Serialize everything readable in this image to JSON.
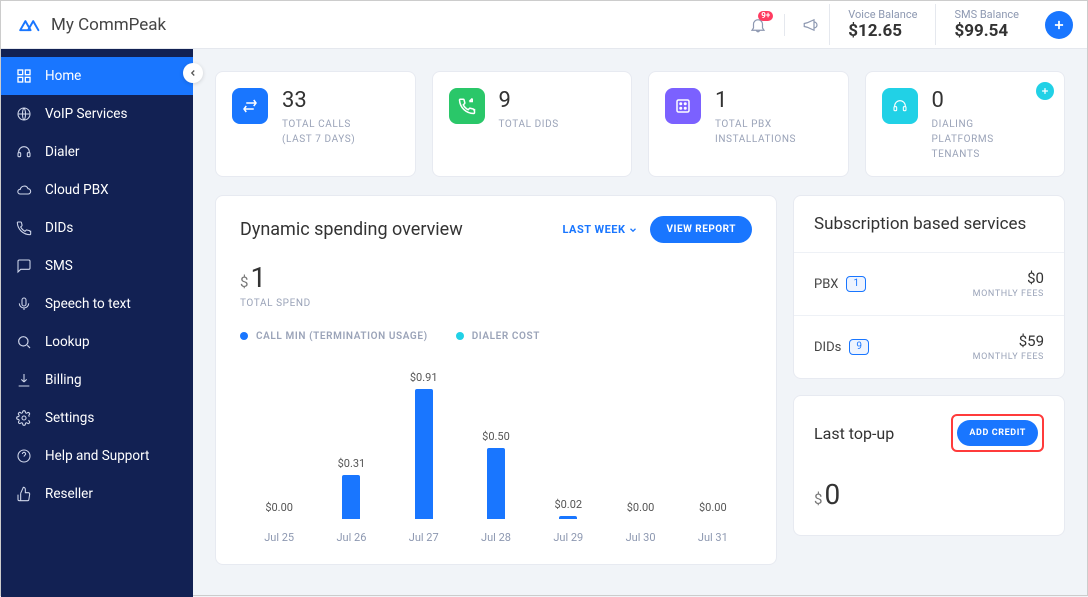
{
  "app_title": "My CommPeak",
  "header": {
    "notif_count": "9+",
    "voice_balance_label": "Voice Balance",
    "voice_balance_value": "$12.65",
    "sms_balance_label": "SMS Balance",
    "sms_balance_value": "$99.54"
  },
  "sidebar": {
    "items": [
      {
        "label": "Home",
        "icon": "grid"
      },
      {
        "label": "VoIP Services",
        "icon": "globe"
      },
      {
        "label": "Dialer",
        "icon": "headset"
      },
      {
        "label": "Cloud PBX",
        "icon": "cloud"
      },
      {
        "label": "DIDs",
        "icon": "phone"
      },
      {
        "label": "SMS",
        "icon": "chat"
      },
      {
        "label": "Speech to text",
        "icon": "mic"
      },
      {
        "label": "Lookup",
        "icon": "search"
      },
      {
        "label": "Billing",
        "icon": "download"
      },
      {
        "label": "Settings",
        "icon": "gear"
      },
      {
        "label": "Help and Support",
        "icon": "help"
      },
      {
        "label": "Reseller",
        "icon": "thumb"
      }
    ]
  },
  "stats": [
    {
      "value": "33",
      "label": "TOTAL CALLS\n(LAST 7 DAYS)",
      "color": "#1976ff",
      "icon": "swap"
    },
    {
      "value": "9",
      "label": "TOTAL DIDS",
      "color": "#2ac769",
      "icon": "call"
    },
    {
      "value": "1",
      "label": "TOTAL PBX\nINSTALLATIONS",
      "color": "#7b61ff",
      "icon": "pbx"
    },
    {
      "value": "0",
      "label": "DIALING\nPLATFORMS\nTENANTS",
      "color": "#21d1e6",
      "icon": "headset",
      "add": true
    }
  ],
  "chart": {
    "title": "Dynamic spending overview",
    "range_label": "LAST WEEK",
    "view_report": "VIEW REPORT",
    "total_spend_value": "1",
    "total_spend_label": "TOTAL SPEND",
    "legend": [
      {
        "label": "CALL MIN (TERMINATION USAGE)",
        "color": "#1976ff"
      },
      {
        "label": "DIALER COST",
        "color": "#21d1e6"
      }
    ]
  },
  "chart_data": {
    "type": "bar",
    "categories": [
      "Jul 25",
      "Jul 26",
      "Jul 27",
      "Jul 28",
      "Jul 29",
      "Jul 30",
      "Jul 31"
    ],
    "values": [
      0.0,
      0.31,
      0.91,
      0.5,
      0.02,
      0.0,
      0.0
    ],
    "labels": [
      "$0.00",
      "$0.31",
      "$0.91",
      "$0.50",
      "$0.02",
      "$0.00",
      "$0.00"
    ],
    "xlabel": "",
    "ylabel": "",
    "ylim": [
      0,
      1
    ]
  },
  "subscriptions": {
    "title": "Subscription based services",
    "rows": [
      {
        "name": "PBX",
        "count": "1",
        "price": "$0",
        "sub": "MONTHLY FEES"
      },
      {
        "name": "DIDs",
        "count": "9",
        "price": "$59",
        "sub": "MONTHLY FEES"
      }
    ]
  },
  "topup": {
    "title": "Last top-up",
    "button": "ADD CREDIT",
    "value": "0"
  }
}
